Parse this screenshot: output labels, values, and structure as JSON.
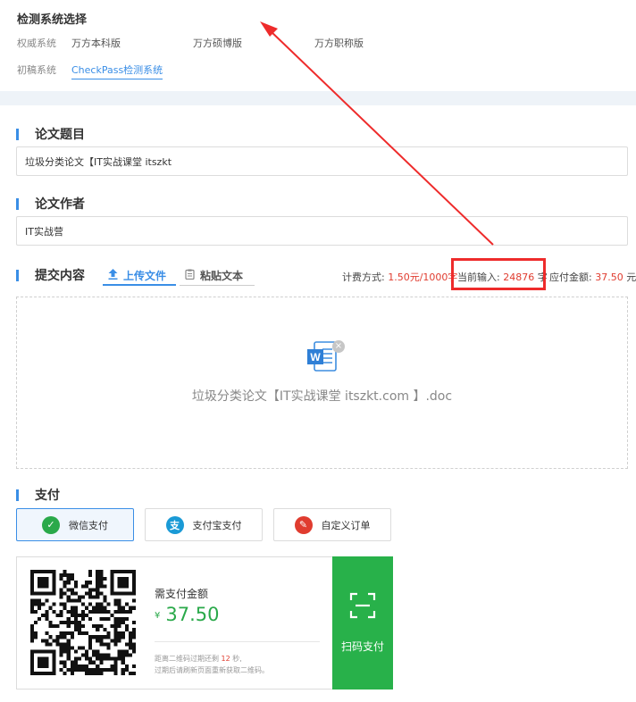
{
  "system_select": {
    "title": "检测系统选择",
    "row1_label": "权威系统",
    "row1_options": [
      "万方本科版",
      "万方硕博版",
      "万方职称版"
    ],
    "row2_label": "初稿系统",
    "row2_active": "CheckPass检测系统"
  },
  "paper_title": {
    "heading": "论文题目",
    "value": "垃圾分类论文【IT实战课堂 itszkt"
  },
  "paper_author": {
    "heading": "论文作者",
    "value": "IT实战营"
  },
  "submit": {
    "heading": "提交内容",
    "tab_upload": "上传文件",
    "tab_paste": "粘贴文本",
    "fee_label": "计费方式:",
    "fee_value": "1.50元/1000字",
    "input_label": "当前输入:",
    "input_value": "24876",
    "input_unit": "字",
    "due_label": "应付金额:",
    "due_value": "37.50",
    "due_unit": "元",
    "file_name": "垃圾分类论文【IT实战课堂 itszkt.com 】.doc"
  },
  "payment": {
    "heading": "支付",
    "methods": [
      {
        "label": "微信支付",
        "icon": "wechat-icon",
        "color": "#2aa94a"
      },
      {
        "label": "支付宝支付",
        "icon": "alipay-icon",
        "color": "#1a9ad6"
      },
      {
        "label": "自定义订单",
        "icon": "pen-icon",
        "color": "#e03c2f"
      }
    ],
    "amount_label": "需支付金额",
    "currency": "¥",
    "amount": "37.50",
    "expire_prefix": "距离二维码过期还剩",
    "expire_seconds": "12",
    "expire_suffix": "秒,",
    "expire_line2": "过期后请刷新页面重新获取二维码。",
    "scan_label": "扫码支付"
  },
  "colors": {
    "accent": "#3a8ee6",
    "price_red": "#e03c2f",
    "pay_green": "#28b14a",
    "highlight": "#ee2b2b"
  }
}
